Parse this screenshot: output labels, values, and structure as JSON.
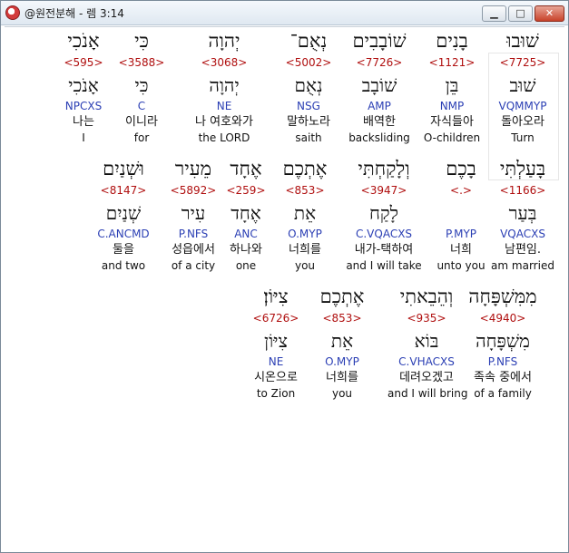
{
  "window": {
    "title": "@원전분해 - 렘 3:14",
    "minimize": "▁",
    "maximize": "□",
    "close": "✕"
  },
  "rows": [
    [
      {
        "heb": "שׁוּבוּ",
        "strong": "<7725>",
        "root": "שׁוּב",
        "morph": "VQMMYP",
        "kor": "돌아오라",
        "eng": "Turn"
      },
      {
        "heb": "בָנִים",
        "strong": "<1121>",
        "root": "בֵּן",
        "morph": "NMP",
        "kor": "자식들아",
        "eng": "O-children"
      },
      {
        "heb": "שׁוֹבָבִים",
        "strong": "<7726>",
        "root": "שׁוֹבָב",
        "morph": "AMP",
        "kor": "배역한",
        "eng": "backsliding"
      },
      {
        "heb": "נְאֻם־",
        "strong": "<5002>",
        "root": "נְאֻם",
        "morph": "NSG",
        "kor": "말하노라",
        "eng": "saith"
      },
      {
        "heb": "יְהוָה",
        "strong": "<3068>",
        "root": "יְהוָה",
        "morph": "NE",
        "kor": "나 여호와가",
        "eng": "the LORD"
      },
      {
        "heb": "כִּי",
        "strong": "<3588>",
        "root": "כִּי",
        "morph": "C",
        "kor": "이니라",
        "eng": "for"
      },
      {
        "heb": "אָנֹכִי",
        "strong": "<595>",
        "root": "אָנֹכִי",
        "morph": "NPCXS",
        "kor": "나는",
        "eng": "I"
      }
    ],
    [
      {
        "heb": "בָּעַלְתִּי",
        "strong": "<1166>",
        "root": "בְּעַר",
        "morph": "VQACXS",
        "kor": "남편임.",
        "eng": "am married"
      },
      {
        "heb": "בָכֶם",
        "strong": "<.>",
        "root": "",
        "morph": "P.MYP",
        "kor": "너희",
        "eng": "unto you"
      },
      {
        "heb": "וְלָקַחְתִּי",
        "strong": "<3947>",
        "root": "לָקַח",
        "morph": "C.VQACXS",
        "kor": "내가-택하여",
        "eng": "and I will take"
      },
      {
        "heb": "אֶתְכֶם",
        "strong": "<853>",
        "root": "אֵת",
        "morph": "O.MYP",
        "kor": "너희를",
        "eng": "you"
      },
      {
        "heb": "אֶחָד",
        "strong": "<259>",
        "root": "אֶחָד",
        "morph": "ANC",
        "kor": "하나와",
        "eng": "one"
      },
      {
        "heb": "מֵעִיר",
        "strong": "<5892>",
        "root": "עִיר",
        "morph": "P.NFS",
        "kor": "성읍에서",
        "eng": "of a city"
      },
      {
        "heb": "וּשְׁנַיִם",
        "strong": "<8147>",
        "root": "שְׁנַיִם",
        "morph": "C.ANCMD",
        "kor": "둘을",
        "eng": "and two"
      }
    ],
    [
      {
        "heb": "מִמִּשְׁפָּחָה",
        "strong": "<4940>",
        "root": "מִשְׁפָּחָה",
        "morph": "P.NFS",
        "kor": "족속 중에서",
        "eng": "of a family"
      },
      {
        "heb": "וְהֵבֵאתִי",
        "strong": "<935>",
        "root": "בּוֹא",
        "morph": "C.VHACXS",
        "kor": "데려오겠고",
        "eng": "and I will bring"
      },
      {
        "heb": "אֶתְכֶם",
        "strong": "<853>",
        "root": "אֵת",
        "morph": "O.MYP",
        "kor": "너희를",
        "eng": "you"
      },
      {
        "heb": "צִיּוֹן׃",
        "strong": "<6726>",
        "root": "צִיּוֹן",
        "morph": "NE",
        "kor": "시온으로",
        "eng": "to Zion"
      }
    ]
  ],
  "colors": {
    "strong": "#b01010",
    "morph": "#2b3fb4",
    "text": "#111111"
  }
}
